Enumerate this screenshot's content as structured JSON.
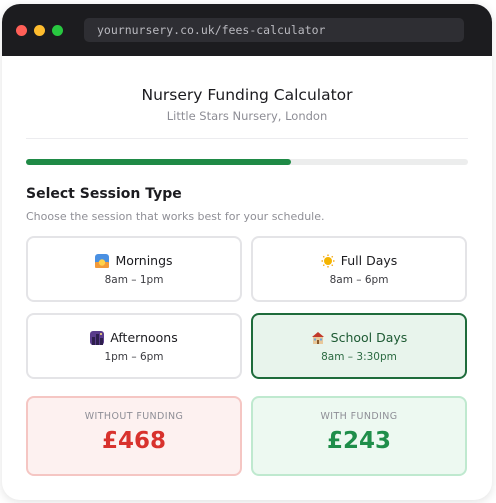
{
  "browser": {
    "url": "yournursery.co.uk/fees-calculator",
    "dots": [
      "#ff5f57",
      "#febc2e",
      "#28c840"
    ]
  },
  "header": {
    "title": "Nursery Funding Calculator",
    "subtitle": "Little Stars Nursery, London"
  },
  "progress": {
    "fraction": 0.6,
    "color": "#1f8a46"
  },
  "section": {
    "title": "Select Session Type",
    "description": "Choose the session that works best for your schedule."
  },
  "sessions": [
    {
      "label": "Mornings",
      "time": "8am – 1pm",
      "icon": "sunrise-icon",
      "selected": false
    },
    {
      "label": "Full Days",
      "time": "8am – 6pm",
      "icon": "sun-icon",
      "selected": false
    },
    {
      "label": "Afternoons",
      "time": "1pm – 6pm",
      "icon": "night-city-icon",
      "selected": false
    },
    {
      "label": "School Days",
      "time": "8am – 3:30pm",
      "icon": "school-icon",
      "selected": true
    }
  ],
  "pricing": {
    "without": {
      "label": "WITHOUT FUNDING",
      "value": "£468",
      "color": "#d8322d"
    },
    "with": {
      "label": "WITH FUNDING",
      "value": "£243",
      "color": "#1f8e4a"
    }
  }
}
